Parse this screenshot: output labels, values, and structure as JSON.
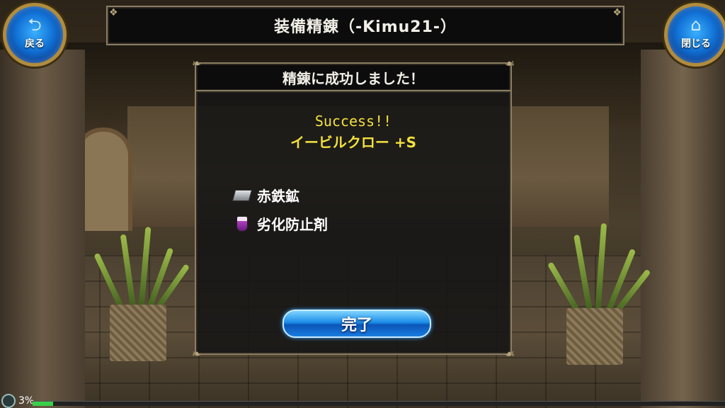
{
  "header": {
    "title": "装備精錬（-Kimu21-）"
  },
  "nav": {
    "back": {
      "label": "戻る",
      "icon": "return-arrow-icon"
    },
    "close": {
      "label": "閉じる",
      "icon": "home-icon"
    }
  },
  "dialog": {
    "heading": "精錬に成功しました！",
    "result_line1": "Success!!",
    "result_line2": "イービルクロー +S",
    "materials": [
      {
        "name": "赤鉄鉱",
        "icon": "ore-icon"
      },
      {
        "name": "劣化防止剤",
        "icon": "potion-icon"
      }
    ],
    "done_label": "完了"
  },
  "status": {
    "percent": "3%",
    "progress": 0.03
  },
  "colors": {
    "accent_yellow": "#f3e13d",
    "button_blue": "#1170d4",
    "frame_gold": "#8b7e63",
    "progress_green": "#3ad04a"
  }
}
